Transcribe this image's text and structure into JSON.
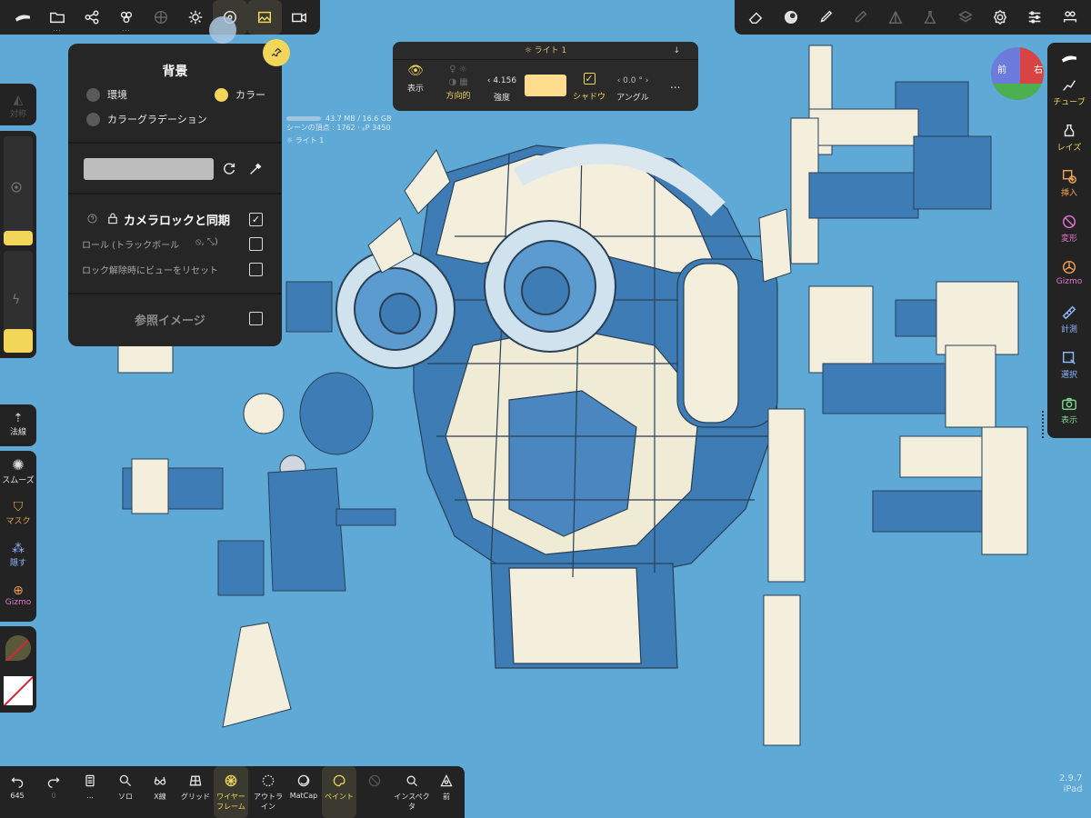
{
  "top_toolbar_left": {
    "icons": [
      "sculpt-brush-icon",
      "folder-icon",
      "scene-graph-icon",
      "layers-icon",
      "wireframe-sphere-icon",
      "sun-icon",
      "material-icon",
      "image-icon",
      "camera-icon"
    ]
  },
  "top_toolbar_right": {
    "icons": [
      "eraser-icon",
      "matcap-icon",
      "brush-icon",
      "pen-icon",
      "symmetry-icon",
      "flask-icon",
      "stack-icon",
      "settings-icon",
      "sliders-icon",
      "users-icon"
    ]
  },
  "background_popover": {
    "title": "背景",
    "radio_environment": "環境",
    "radio_color": "カラー",
    "radio_gradient": "カラーグラデーション",
    "camera_lock_label": "カメラロックと同期",
    "roll_label": "ロール (トラックボール",
    "reset_view_label": "ロック解除時にビューをリセット",
    "reference_image_label": "参照イメージ",
    "color_swatch_value": "#bdbdbd"
  },
  "light_panel": {
    "header": "ライト 1",
    "show_label": "表示",
    "directional_label": "方向的",
    "intensity_value": "4.156",
    "intensity_label": "強度",
    "shadow_label": "シャドウ",
    "angle_value": "0.0 °",
    "angle_label": "アングル",
    "color": "#fddc8e",
    "more": "..."
  },
  "scene_stats": {
    "memory": "43.7 MB / 16.6 GB",
    "vertices": "シーンの頂点 : 1762 · ₚP 3450",
    "light": "ライト 1"
  },
  "left_panel": {
    "symmetry_label": "対称",
    "normal_label": "法線",
    "smooth_label": "スムーズ",
    "mask_label": "マスク",
    "hide_label": "隠す",
    "gizmo_label": "Gizmo"
  },
  "right_toolbar": {
    "tube": "チューブ",
    "lathe": "レイズ",
    "insert": "挿入",
    "transform": "変形",
    "gizmo": "Gizmo",
    "measure": "計測",
    "select": "選択",
    "view": "表示"
  },
  "nav_cube": {
    "front": "前",
    "right": "右"
  },
  "bottom_toolbar": {
    "undo": "645",
    "redo": "0",
    "more": "...",
    "solo": "ソロ",
    "xray": "X線",
    "grid": "グリッド",
    "wireframe": "ワイヤーフレーム",
    "outline": "アウトライン",
    "matcap": "MatCap",
    "paint": "ペイント",
    "inspector": "インスペクタ",
    "front": "前"
  },
  "version": {
    "number": "2.9.7",
    "device": "iPad"
  },
  "colors": {
    "accent": "#f1d65a",
    "viewport_bg": "#5fa9d6",
    "panel_bg": "#232323"
  }
}
